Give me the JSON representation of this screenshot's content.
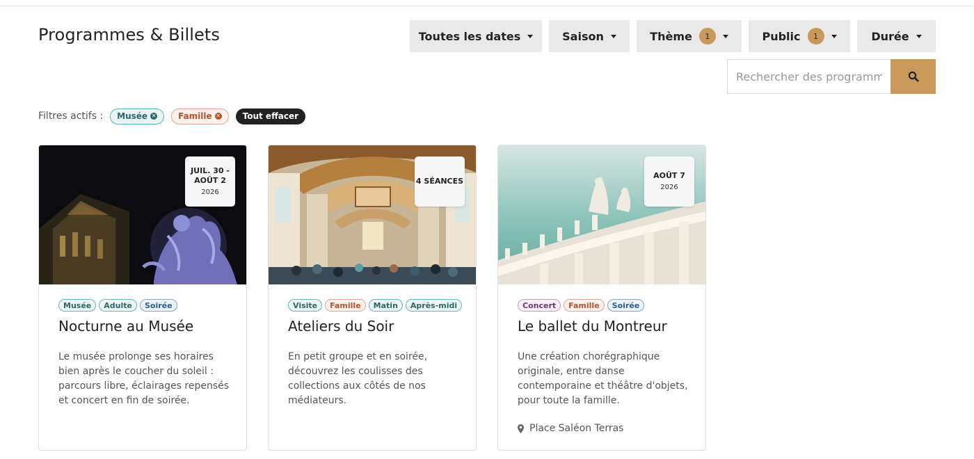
{
  "page": {
    "title": "Programmes & Billets"
  },
  "filters": {
    "dates": {
      "label": "Toutes les dates"
    },
    "saison": {
      "label": "Saison"
    },
    "theme": {
      "label": "Thème",
      "count": "1"
    },
    "public": {
      "label": "Public",
      "count": "1"
    },
    "duree": {
      "label": "Durée"
    }
  },
  "search": {
    "placeholder": "Rechercher des programmes"
  },
  "active_filters": {
    "label": "Filtres actifs :",
    "chips": [
      "Musée",
      "Famille"
    ],
    "clear_label": "Tout effacer"
  },
  "cards": [
    {
      "date": "JUIL. 30 - AOÛT 2",
      "year": "2026",
      "tags": [
        "Musée",
        "Adulte",
        "Soirée"
      ],
      "title": "Nocturne au Musée",
      "description": "Le musée prolonge ses horaires bien après le coucher du soleil : parcours libre, éclairages repensés et concert en fin de soirée."
    },
    {
      "date": "4 SÉANCES",
      "tags": [
        "Visite",
        "Famille",
        "Matin",
        "Après-midi"
      ],
      "title": "Ateliers du Soir",
      "description": "En petit groupe et en soirée, découvrez les coulisses des collections aux côtés de nos médiateurs."
    },
    {
      "date": "AOÛT 7",
      "year": "2026",
      "tags": [
        "Concert",
        "Famille",
        "Soirée"
      ],
      "title": "Le ballet du Montreur",
      "description": "Une création chorégraphique originale, entre danse contemporaine et théâtre d'objets, pour toute la famille.",
      "location": "Place Saléon Terras"
    }
  ],
  "colors": {
    "accent": "#c9995a",
    "button_bg": "#e9e9e9",
    "dark_chip": "#222222"
  },
  "icons": {
    "search": "search-icon",
    "remove": "close-circle-icon",
    "caret": "caret-down-icon",
    "location": "map-pin-icon"
  }
}
